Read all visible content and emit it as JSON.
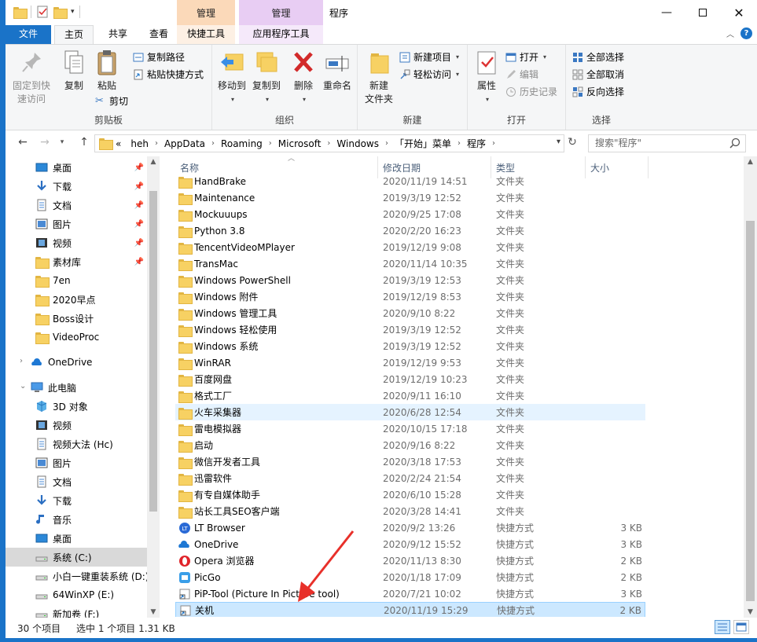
{
  "window": {
    "title": "程序",
    "context_tab_manage_1": "管理",
    "context_tab_manage_2": "管理"
  },
  "tabs": {
    "file": "文件",
    "home": "主页",
    "share": "共享",
    "view": "查看",
    "shortcut_tools": "快捷工具",
    "app_tools": "应用程序工具"
  },
  "ribbon": {
    "clipboard": {
      "label": "剪贴板",
      "pin_quick_access": "固定到快\n速访问",
      "copy": "复制",
      "paste": "粘贴",
      "copy_path": "复制路径",
      "paste_shortcut": "粘贴快捷方式",
      "cut": "剪切"
    },
    "organize": {
      "label": "组织",
      "move_to": "移动到",
      "copy_to": "复制到",
      "delete": "删除",
      "rename": "重命名"
    },
    "new": {
      "label": "新建",
      "new_folder": "新建\n文件夹",
      "new_item": "新建项目",
      "easy_access": "轻松访问"
    },
    "open": {
      "label": "打开",
      "properties": "属性",
      "open": "打开",
      "edit": "编辑",
      "history": "历史记录"
    },
    "select": {
      "label": "选择",
      "select_all": "全部选择",
      "select_none": "全部取消",
      "invert": "反向选择"
    }
  },
  "address": {
    "overflow": "«",
    "crumbs": [
      "heh",
      "AppData",
      "Roaming",
      "Microsoft",
      "Windows",
      "「开始」菜单",
      "程序"
    ],
    "search_placeholder": "搜索\"程序\""
  },
  "nav": {
    "items": [
      {
        "label": "桌面",
        "icon": "desktop-icon",
        "pinned": true
      },
      {
        "label": "下载",
        "icon": "download-icon",
        "pinned": true
      },
      {
        "label": "文档",
        "icon": "document-icon",
        "pinned": true
      },
      {
        "label": "图片",
        "icon": "picture-icon",
        "pinned": true
      },
      {
        "label": "视频",
        "icon": "video-icon",
        "pinned": true
      },
      {
        "label": "素材库",
        "icon": "folder-icon",
        "pinned": true
      },
      {
        "label": "7en",
        "icon": "folder-icon"
      },
      {
        "label": "2020早点",
        "icon": "folder-icon"
      },
      {
        "label": "Boss设计",
        "icon": "folder-icon"
      },
      {
        "label": "VideoProc",
        "icon": "folder-icon"
      },
      {
        "label": "OneDrive",
        "icon": "onedrive-icon"
      },
      {
        "label": "此电脑",
        "icon": "computer-icon"
      },
      {
        "label": "3D 对象",
        "icon": "3d-objects-icon"
      },
      {
        "label": "视频",
        "icon": "video-icon"
      },
      {
        "label": "视频大法 (Hc)",
        "icon": "document-icon"
      },
      {
        "label": "图片",
        "icon": "picture-icon"
      },
      {
        "label": "文档",
        "icon": "document-icon"
      },
      {
        "label": "下载",
        "icon": "download-icon"
      },
      {
        "label": "音乐",
        "icon": "music-icon"
      },
      {
        "label": "桌面",
        "icon": "desktop-icon"
      },
      {
        "label": "系统 (C:)",
        "icon": "drive-icon",
        "selected": true
      },
      {
        "label": "小白一键重装系统 (D:)",
        "icon": "drive-icon"
      },
      {
        "label": "64WinXP  (E:)",
        "icon": "drive-icon"
      },
      {
        "label": "新加卷 (F:)",
        "icon": "drive-icon"
      }
    ]
  },
  "columns": {
    "name": "名称",
    "date": "修改日期",
    "type": "类型",
    "size": "大小"
  },
  "files": [
    {
      "name": "HandBrake",
      "date": "2020/11/19 14:51",
      "type": "文件夹",
      "size": "",
      "icon": "folder"
    },
    {
      "name": "Maintenance",
      "date": "2019/3/19 12:52",
      "type": "文件夹",
      "size": "",
      "icon": "folder"
    },
    {
      "name": "Mockuuups",
      "date": "2020/9/25 17:08",
      "type": "文件夹",
      "size": "",
      "icon": "folder"
    },
    {
      "name": "Python 3.8",
      "date": "2020/2/20 16:23",
      "type": "文件夹",
      "size": "",
      "icon": "folder"
    },
    {
      "name": "TencentVideoMPlayer",
      "date": "2019/12/19 9:08",
      "type": "文件夹",
      "size": "",
      "icon": "folder"
    },
    {
      "name": "TransMac",
      "date": "2020/11/14 10:35",
      "type": "文件夹",
      "size": "",
      "icon": "folder"
    },
    {
      "name": "Windows PowerShell",
      "date": "2019/3/19 12:53",
      "type": "文件夹",
      "size": "",
      "icon": "folder"
    },
    {
      "name": "Windows 附件",
      "date": "2019/12/19 8:53",
      "type": "文件夹",
      "size": "",
      "icon": "folder"
    },
    {
      "name": "Windows 管理工具",
      "date": "2020/9/10 8:22",
      "type": "文件夹",
      "size": "",
      "icon": "folder"
    },
    {
      "name": "Windows 轻松使用",
      "date": "2019/3/19 12:52",
      "type": "文件夹",
      "size": "",
      "icon": "folder"
    },
    {
      "name": "Windows 系统",
      "date": "2019/3/19 12:52",
      "type": "文件夹",
      "size": "",
      "icon": "folder"
    },
    {
      "name": "WinRAR",
      "date": "2019/12/19 9:53",
      "type": "文件夹",
      "size": "",
      "icon": "folder"
    },
    {
      "name": "百度网盘",
      "date": "2019/12/19 10:23",
      "type": "文件夹",
      "size": "",
      "icon": "folder"
    },
    {
      "name": "格式工厂",
      "date": "2020/9/11 16:10",
      "type": "文件夹",
      "size": "",
      "icon": "folder"
    },
    {
      "name": "火车采集器",
      "date": "2020/6/28 12:54",
      "type": "文件夹",
      "size": "",
      "icon": "folder",
      "hover": true
    },
    {
      "name": "雷电模拟器",
      "date": "2020/10/15 17:18",
      "type": "文件夹",
      "size": "",
      "icon": "folder"
    },
    {
      "name": "启动",
      "date": "2020/9/16 8:22",
      "type": "文件夹",
      "size": "",
      "icon": "folder"
    },
    {
      "name": "微信开发者工具",
      "date": "2020/3/18 17:53",
      "type": "文件夹",
      "size": "",
      "icon": "folder"
    },
    {
      "name": "迅雷软件",
      "date": "2020/2/24 21:54",
      "type": "文件夹",
      "size": "",
      "icon": "folder"
    },
    {
      "name": "有专自媒体助手",
      "date": "2020/6/10 15:28",
      "type": "文件夹",
      "size": "",
      "icon": "folder"
    },
    {
      "name": "站长工具SEO客户端",
      "date": "2020/3/28 14:41",
      "type": "文件夹",
      "size": "",
      "icon": "folder"
    },
    {
      "name": "LT Browser",
      "date": "2020/9/2 13:26",
      "type": "快捷方式",
      "size": "3 KB",
      "icon": "lt-browser"
    },
    {
      "name": "OneDrive",
      "date": "2020/9/12 15:52",
      "type": "快捷方式",
      "size": "3 KB",
      "icon": "onedrive"
    },
    {
      "name": "Opera 浏览器",
      "date": "2020/11/13 8:30",
      "type": "快捷方式",
      "size": "2 KB",
      "icon": "opera"
    },
    {
      "name": "PicGo",
      "date": "2020/1/18 17:09",
      "type": "快捷方式",
      "size": "2 KB",
      "icon": "picgo"
    },
    {
      "name": "PiP-Tool  (Picture In Picture tool)",
      "date": "2020/7/21 10:02",
      "type": "快捷方式",
      "size": "3 KB",
      "icon": "shortcut"
    },
    {
      "name": "关机",
      "date": "2020/11/19 15:29",
      "type": "快捷方式",
      "size": "2 KB",
      "icon": "shortcut",
      "selected": true
    }
  ],
  "status": {
    "item_count": "30 个项目",
    "selection": "选中 1 个项目  1.31 KB"
  },
  "colors": {
    "accent": "#1a73c8",
    "selection": "#cce8ff",
    "hover": "#e5f3ff",
    "annotation_arrow": "#e8302a"
  }
}
